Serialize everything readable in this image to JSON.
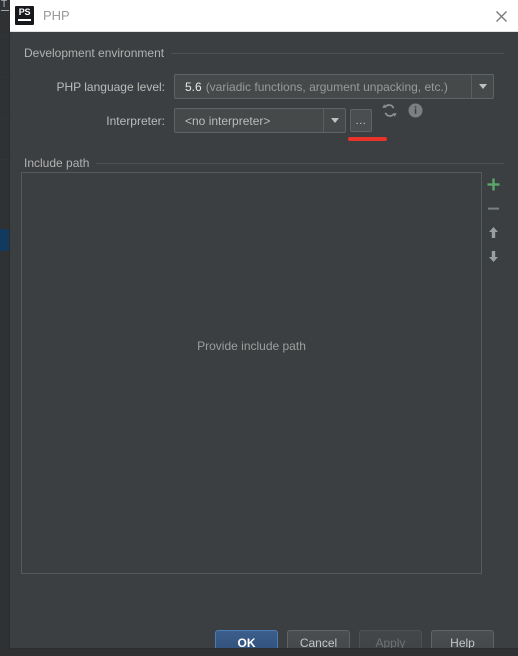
{
  "backdrop": {
    "left_tab_letter": "T"
  },
  "dialog": {
    "title": "PHP",
    "icon_name": "phpstorm-logo-icon",
    "close_label": "×",
    "sections": {
      "development_environment": {
        "label": "Development environment",
        "fields": {
          "php_language_level": {
            "label": "PHP language level:",
            "value_primary": "5.6",
            "value_secondary": "(variadic functions, argument unpacking, etc.)"
          },
          "interpreter": {
            "label": "Interpreter:",
            "value": "<no interpreter>",
            "browse_label": "...",
            "refresh_icon": "refresh-icon",
            "info_icon": "info-icon"
          }
        }
      },
      "include_path": {
        "label": "Include path",
        "placeholder": "Provide include path",
        "toolbar": [
          {
            "name": "add-button",
            "icon": "plus-icon",
            "color": "#59a869"
          },
          {
            "name": "remove-button",
            "icon": "minus-icon",
            "color": "#7a7f81"
          },
          {
            "name": "move-up-button",
            "icon": "arrow-up-icon",
            "color": "#9a9fa1"
          },
          {
            "name": "move-down-button",
            "icon": "arrow-down-icon",
            "color": "#9a9fa1"
          }
        ]
      }
    },
    "footer": {
      "ok": "OK",
      "cancel": "Cancel",
      "apply": "Apply",
      "help": "Help"
    }
  },
  "annotation": {
    "color": "#e8322a",
    "target": "browse-button"
  }
}
